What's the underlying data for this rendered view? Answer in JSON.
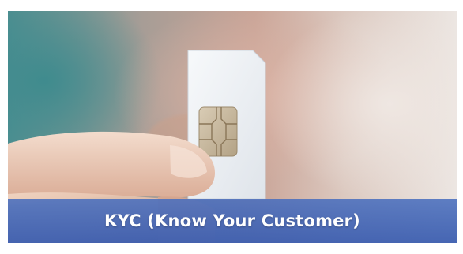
{
  "caption": {
    "text": "KYC (Know Your Customer)"
  },
  "colors": {
    "band": "#4a6fbe",
    "sim_card": "#eef1f4",
    "chip": "#c8b9a1"
  },
  "icons": {
    "main_subject": "sim-card-icon"
  }
}
